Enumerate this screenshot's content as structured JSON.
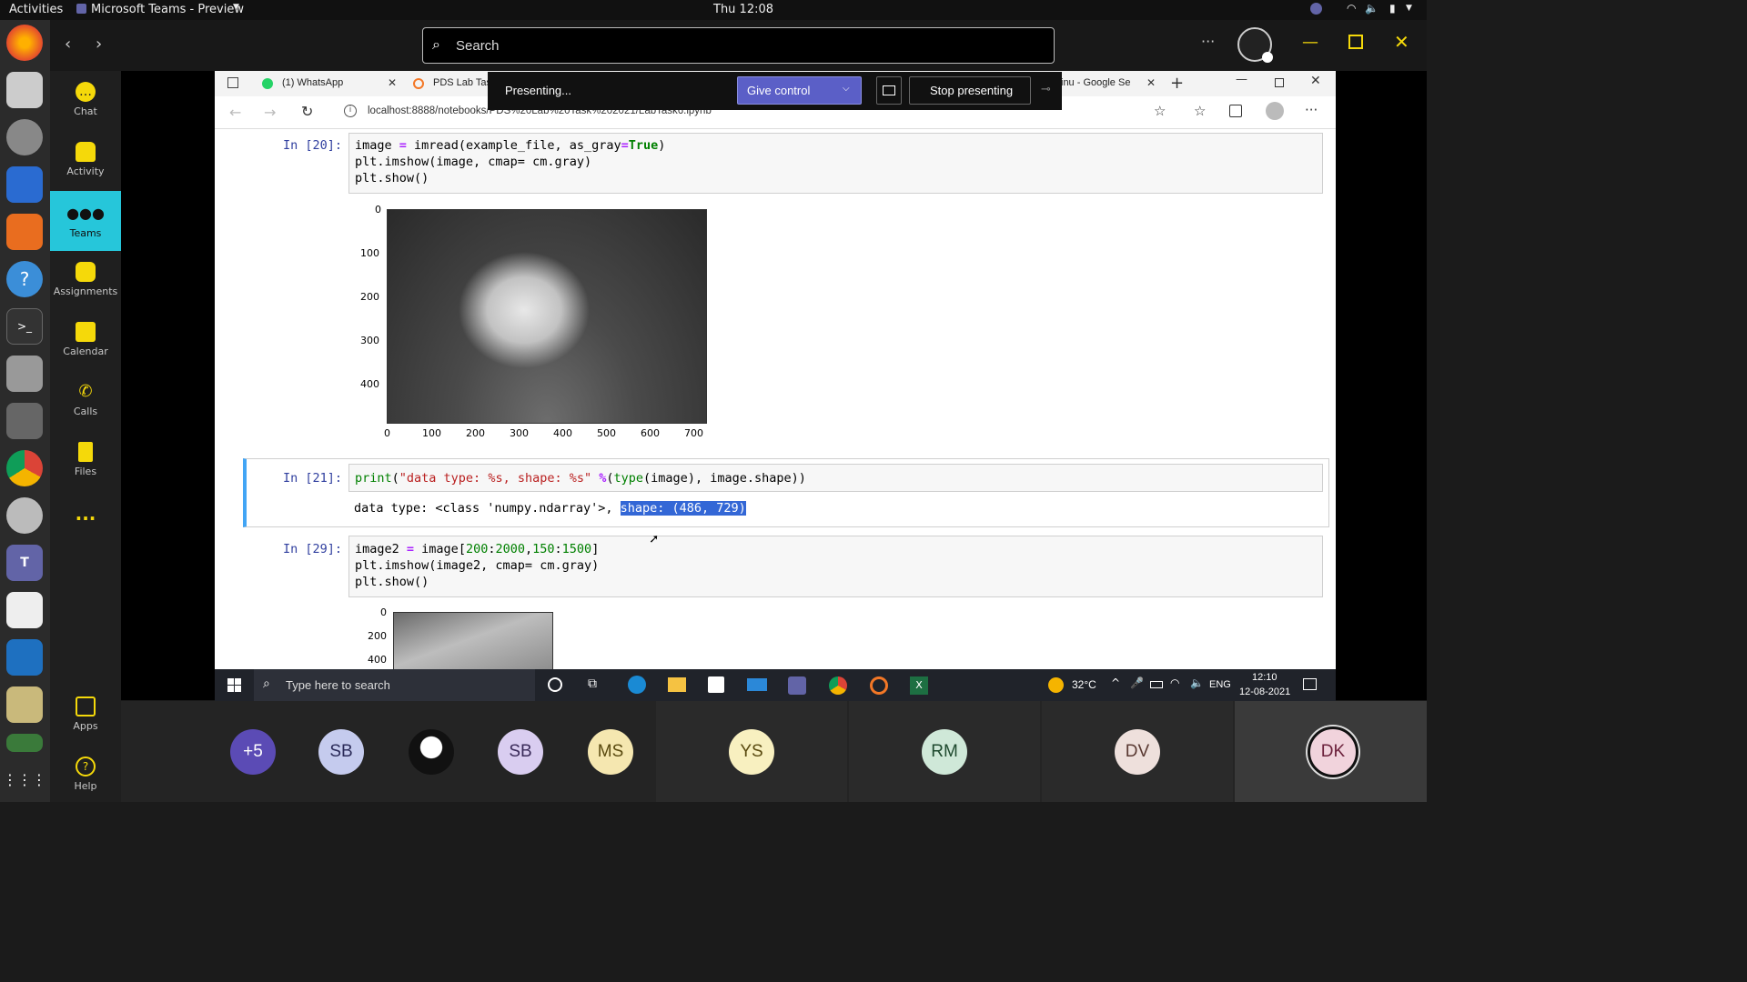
{
  "os_topbar": {
    "activities": "Activities",
    "app_name": "Microsoft Teams - Preview",
    "clock": "Thu 12:08"
  },
  "teams_header": {
    "search_placeholder": "Search"
  },
  "rail": {
    "items": [
      {
        "label": "Chat"
      },
      {
        "label": "Activity"
      },
      {
        "label": "Teams"
      },
      {
        "label": "Assignments"
      },
      {
        "label": "Calendar"
      },
      {
        "label": "Calls"
      },
      {
        "label": "Files"
      },
      {
        "label": "..."
      }
    ],
    "apps": "Apps",
    "help": "Help"
  },
  "presenting_bar": {
    "status": "Presenting...",
    "give_control": "Give control",
    "stop": "Stop presenting"
  },
  "browser": {
    "tabs": [
      {
        "label": "(1) WhatsApp"
      },
      {
        "label": "PDS Lab Tas"
      },
      {
        "label": "inu - Google Se"
      }
    ],
    "url": "localhost:8888/notebooks/PDS%20Lab%20Task%202021/LabTask6.ipynb"
  },
  "notebook": {
    "cells": [
      {
        "prompt": "In [20]:",
        "lines": [
          "image = imread(example_file, as_gray=True)",
          "plt.imshow(image, cmap= cm.gray)",
          "plt.show()"
        ]
      },
      {
        "prompt": "In [21]:",
        "lines": [
          "print(\"data type: %s, shape: %s\" %(type(image), image.shape))"
        ],
        "output_prefix": "data type: <class 'numpy.ndarray'>, ",
        "output_selected": "shape: (486, 729)"
      },
      {
        "prompt": "In [29]:",
        "lines": [
          "image2 = image[200:2000,150:1500]",
          "plt.imshow(image2, cmap= cm.gray)",
          "plt.show()"
        ]
      }
    ],
    "plot1": {
      "xticks": [
        "0",
        "100",
        "200",
        "300",
        "400",
        "500",
        "600",
        "700"
      ],
      "yticks": [
        "0",
        "100",
        "200",
        "300",
        "400"
      ]
    },
    "plot2": {
      "yticks": [
        "0",
        "200",
        "400"
      ]
    }
  },
  "win_taskbar": {
    "search_placeholder": "Type here to search",
    "weather": "32°C",
    "lang": "ENG",
    "time": "12:10",
    "date": "12-08-2021"
  },
  "participants": [
    {
      "initials": "+5",
      "bg": "#5b4bb5",
      "fg": "#ffffff"
    },
    {
      "initials": "SB",
      "bg": "#c5cbee",
      "fg": "#2b2b59"
    },
    {
      "initials": "",
      "bg": "#1e1e1e",
      "fg": "#ffffff"
    },
    {
      "initials": "SB",
      "bg": "#d9cdf0",
      "fg": "#3a2b59"
    },
    {
      "initials": "MS",
      "bg": "#f5e7b0",
      "fg": "#5a4a10"
    },
    {
      "initials": "YS",
      "bg": "#f8f0c0",
      "fg": "#5a4a10"
    },
    {
      "initials": "RM",
      "bg": "#cfe8d8",
      "fg": "#1f4a2f"
    },
    {
      "initials": "DV",
      "bg": "#eee0dc",
      "fg": "#5a3a33"
    },
    {
      "initials": "DK",
      "bg": "#f1d3dc",
      "fg": "#6b1f3a"
    }
  ]
}
